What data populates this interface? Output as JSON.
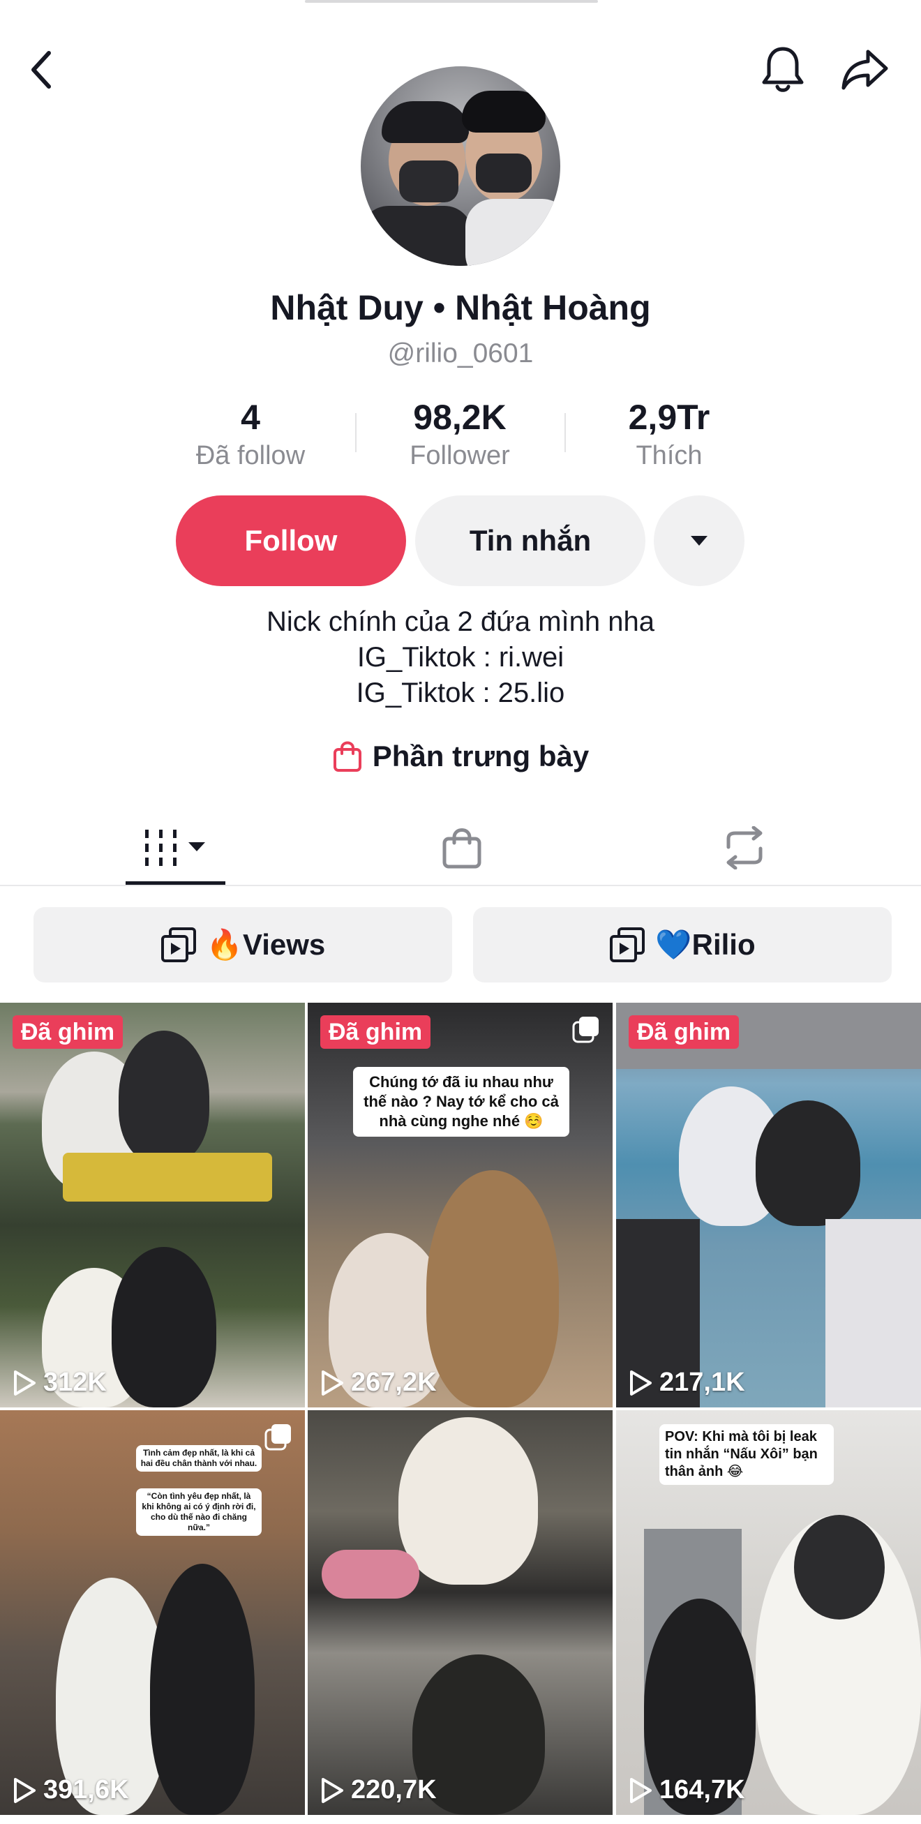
{
  "profile": {
    "display_name": "Nhật Duy • Nhật Hoàng",
    "username": "@rilio_0601"
  },
  "stats": [
    {
      "value": "4",
      "label": "Đã follow"
    },
    {
      "value": "98,2K",
      "label": "Follower"
    },
    {
      "value": "2,9Tr",
      "label": "Thích"
    }
  ],
  "actions": {
    "follow_label": "Follow",
    "message_label": "Tin nhắn"
  },
  "bio": {
    "line1": "Nick chính của 2 đứa mình nha",
    "line2": "IG_Tiktok : ri.wei",
    "line3": "IG_Tiktok : 25.lio"
  },
  "showcase_label": "Phần trưng bày",
  "playlists": [
    {
      "label": "🔥Views"
    },
    {
      "label": "💙Rilio"
    }
  ],
  "colors": {
    "accent": "#ea3e5a",
    "text": "#161823",
    "muted": "#8a8b91",
    "button_bg": "#f1f1f2"
  },
  "videos": [
    {
      "pinned_label": "Đã ghim",
      "views": "312K"
    },
    {
      "pinned_label": "Đã ghim",
      "views": "267,2K",
      "caption": "Chúng tớ đã iu nhau như thế nào ? Nay tớ kể cho cả nhà cùng nghe nhé ☺️"
    },
    {
      "pinned_label": "Đã ghim",
      "views": "217,1K"
    },
    {
      "views": "391,6K",
      "caption": "Tình cảm đẹp nhất, là khi cả hai đều chân thành với nhau.",
      "caption2": "“Còn tình yêu đẹp nhất, là khi không ai có ý định rời đi, cho dù thế nào đi chăng nữa.”"
    },
    {
      "views": "220,7K"
    },
    {
      "views": "164,7K",
      "caption": "POV: Khi mà tôi bị leak tin nhắn “Nấu Xôi” bạn thân ảnh 😂"
    }
  ]
}
